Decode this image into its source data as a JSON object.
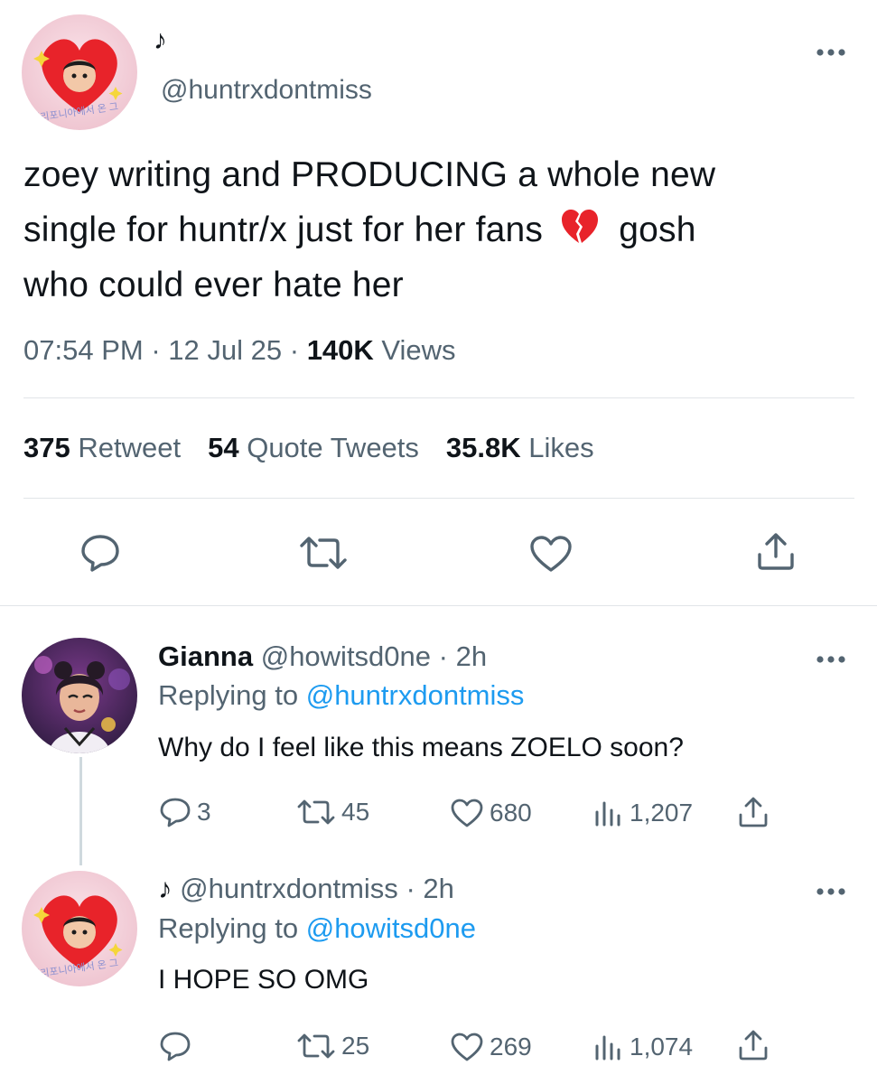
{
  "main_tweet": {
    "display_name": "♪",
    "handle": "@huntrxdontmiss",
    "avatar_icon": "heart-avatar-icon",
    "avatar_caption": "캘리포니아에서 온 그",
    "text_line1": "zoey writing and PRODUCING a whole new",
    "text_line2a": "single for huntr/x just for her fans",
    "emoji": "💔",
    "text_line2b": "gosh",
    "text_line3": "who could ever hate her",
    "time": "07:54 PM",
    "date": "12 Jul 25",
    "views_count": "140K",
    "views_label": "Views",
    "retweets_count": "375",
    "retweets_label": "Retweet",
    "quotes_count": "54",
    "quotes_label": "Quote Tweets",
    "likes_count": "35.8K",
    "likes_label": "Likes"
  },
  "replies": [
    {
      "display_name": "Gianna",
      "handle": "@howitsd0ne",
      "time": "2h",
      "replying_label": "Replying to",
      "replying_to": "@huntrxdontmiss",
      "text": "Why do I feel like this means ZOELO soon?",
      "reply_count": "3",
      "retweet_count": "45",
      "like_count": "680",
      "view_count": "1,207"
    },
    {
      "display_name": "♪",
      "handle": "@huntrxdontmiss",
      "time": "2h",
      "replying_label": "Replying to",
      "replying_to": "@howitsd0ne",
      "text": "I HOPE SO OMG",
      "reply_count": "",
      "retweet_count": "25",
      "like_count": "269",
      "view_count": "1,074"
    }
  ],
  "separator": "·",
  "colors": {
    "text": "#0f1419",
    "muted": "#536471",
    "link": "#1d9bf0",
    "divider": "#e1e5e8",
    "heart_red": "#e8232a"
  }
}
